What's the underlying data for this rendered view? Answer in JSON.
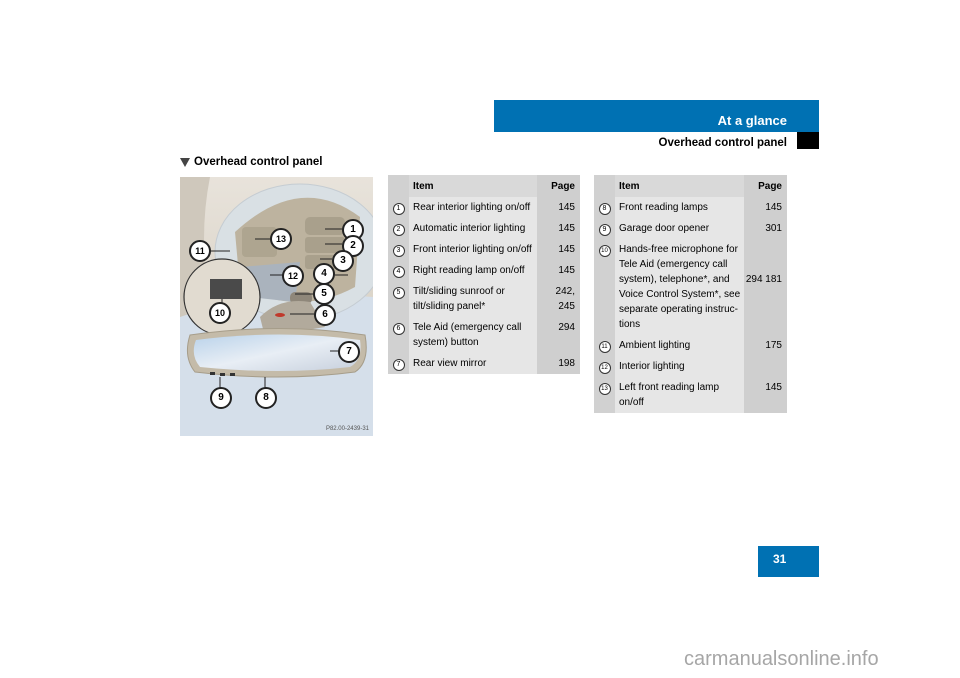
{
  "header": {
    "chapter": "At a glance",
    "section": "Overhead control panel"
  },
  "section_title": "Overhead control panel",
  "illustration": {
    "code": "P82.00-2439-31",
    "callouts": [
      "1",
      "2",
      "3",
      "4",
      "5",
      "6",
      "7",
      "8",
      "9",
      "10",
      "11",
      "12",
      "13"
    ]
  },
  "table_left": {
    "headers": {
      "item": "Item",
      "page": "Page"
    },
    "rows": [
      {
        "num": "1",
        "item": "Rear interior lighting on/off",
        "page": "145"
      },
      {
        "num": "2",
        "item": "Automatic interior lighting",
        "page": "145"
      },
      {
        "num": "3",
        "item": "Front interior lighting on/off",
        "page": "145"
      },
      {
        "num": "4",
        "item": "Right reading lamp on/off",
        "page": "145"
      },
      {
        "num": "5",
        "item": "Tilt/sliding sunroof or tilt/sliding panel*",
        "page": "242, 245"
      },
      {
        "num": "6",
        "item": "Tele Aid (emergency call system) button",
        "page": "294"
      },
      {
        "num": "7",
        "item": "Rear view mirror",
        "page": "198"
      }
    ]
  },
  "table_right": {
    "headers": {
      "item": "Item",
      "page": "Page"
    },
    "rows": [
      {
        "num": "8",
        "item": "Front reading lamps",
        "page": "145"
      },
      {
        "num": "9",
        "item": "Garage door opener",
        "page": "301"
      },
      {
        "num": "10",
        "item": "Hands-free microphone for Tele Aid (emergency call system), telephone*, and Voice Control System*, see separate operating instruc-tions",
        "page": "294 181"
      },
      {
        "num": "11",
        "item": "Ambient lighting",
        "page": "175"
      },
      {
        "num": "12",
        "item": "Interior lighting",
        "page": ""
      },
      {
        "num": "13",
        "item": "Left front reading lamp on/off",
        "page": "145"
      }
    ]
  },
  "page_number": "31",
  "watermark": "carmanualsonline.info",
  "colors": {
    "brand_blue": "#0071b3",
    "table_bg": "#e6e6e6"
  }
}
